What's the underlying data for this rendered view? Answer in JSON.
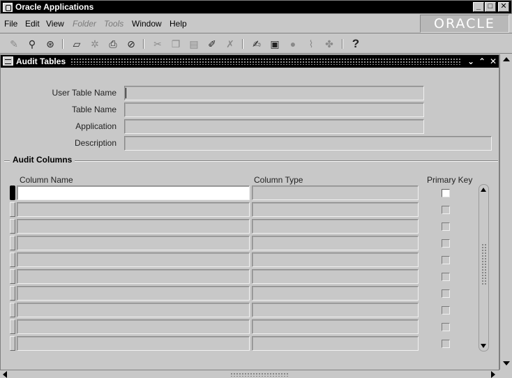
{
  "window": {
    "title": "Oracle Applications",
    "controls": {
      "minimize": "_",
      "maximize": "□",
      "close": "✕"
    }
  },
  "menubar": {
    "items": [
      {
        "label": "File",
        "enabled": true
      },
      {
        "label": "Edit",
        "enabled": true
      },
      {
        "label": "View",
        "enabled": true
      },
      {
        "label": "Folder",
        "enabled": false
      },
      {
        "label": "Tools",
        "enabled": false
      },
      {
        "label": "Window",
        "enabled": true
      },
      {
        "label": "Help",
        "enabled": true
      }
    ],
    "brand": "ORACLE"
  },
  "toolbar": {
    "icons": [
      "new-icon",
      "find-icon",
      "navigator-icon",
      "save-icon",
      "next-step-icon",
      "print-icon",
      "close-form-icon",
      "cut-icon",
      "copy-icon",
      "paste-icon",
      "new-record-icon",
      "delete-record-icon",
      "edit-field-icon",
      "zoom-icon",
      "translations-icon",
      "attachments-icon",
      "folder-tools-icon",
      "help-icon"
    ],
    "help_glyph": "?"
  },
  "form": {
    "title": "Audit Tables",
    "title_controls": {
      "minimize": "⌄",
      "restore": "⌃",
      "close": "✕"
    },
    "fields": {
      "user_table_name": {
        "label": "User Table Name",
        "value": ""
      },
      "table_name": {
        "label": "Table Name",
        "value": ""
      },
      "application": {
        "label": "Application",
        "value": ""
      },
      "description": {
        "label": "Description",
        "value": ""
      }
    },
    "audit_columns": {
      "section_title": "Audit Columns",
      "headers": {
        "column_name": "Column Name",
        "column_type": "Column Type",
        "primary_key": "Primary Key"
      },
      "rows": [
        {
          "column_name": "",
          "column_type": "",
          "primary_key": false
        },
        {
          "column_name": "",
          "column_type": "",
          "primary_key": false
        },
        {
          "column_name": "",
          "column_type": "",
          "primary_key": false
        },
        {
          "column_name": "",
          "column_type": "",
          "primary_key": false
        },
        {
          "column_name": "",
          "column_type": "",
          "primary_key": false
        },
        {
          "column_name": "",
          "column_type": "",
          "primary_key": false
        },
        {
          "column_name": "",
          "column_type": "",
          "primary_key": false
        },
        {
          "column_name": "",
          "column_type": "",
          "primary_key": false
        },
        {
          "column_name": "",
          "column_type": "",
          "primary_key": false
        },
        {
          "column_name": "",
          "column_type": "",
          "primary_key": false
        }
      ]
    }
  }
}
